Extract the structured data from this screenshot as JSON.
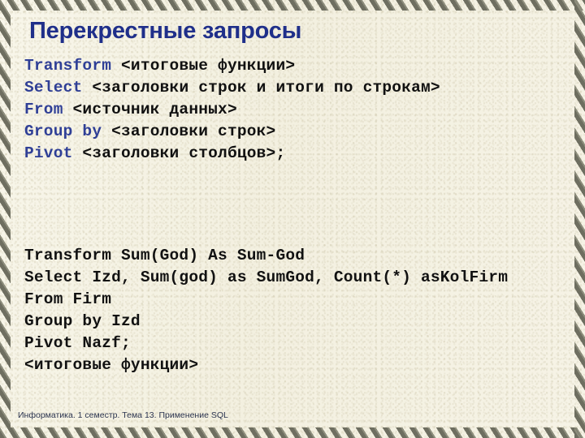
{
  "slide": {
    "title": "Перекрестные запросы",
    "footer": "Информатика. 1 семестр. Тема 13. Применение SQL",
    "colors": {
      "title": "#1f2f8a",
      "keyword": "#2f3f96",
      "body_text": "#111111",
      "footer_text": "#2c3550",
      "background": "#f6f3e6",
      "frame_stripe_dark": "#6e6e60",
      "frame_stripe_light": "#8d8d7c"
    }
  },
  "syntax_block": {
    "lines": [
      {
        "keyword": "Transform",
        "argument": " <итоговые функции>",
        "wrapped": ""
      },
      {
        "keyword": "Select",
        "argument": " <заголовки строк и итоги по",
        "wrapped": "строкам>"
      },
      {
        "keyword": "From",
        "argument": " <источник данных>",
        "wrapped": ""
      },
      {
        "keyword": "Group by",
        "argument": " <заголовки строк>",
        "wrapped": ""
      },
      {
        "keyword": "Pivot",
        "argument": " <заголовки столбцов>;",
        "wrapped": ""
      }
    ]
  },
  "example_block": {
    "lines": [
      "Transform Sum(God) As Sum-God",
      "Select Izd, Sum(god) as SumGod, Count(*) asKolFirm",
      "From Firm",
      "Group by Izd",
      "Pivot Nazf;",
      "<итоговые функции>"
    ]
  }
}
